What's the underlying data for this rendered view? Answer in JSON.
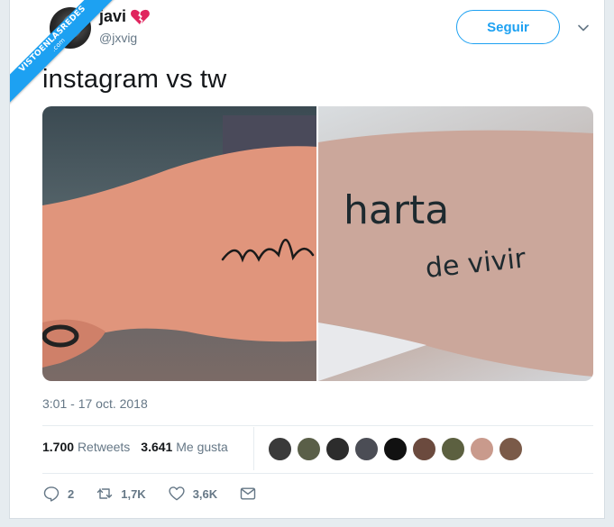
{
  "watermark": {
    "line1": "VISTOENLASREDES",
    "line2": ".com"
  },
  "tweet": {
    "author_name": "javi",
    "author_handle": "@jxvig",
    "follow_label": "Seguir",
    "text": "instagram vs tw",
    "timestamp": "3:01 - 17 oct. 2018"
  },
  "stats": {
    "retweets_count": "1.700",
    "retweets_label": "Retweets",
    "likes_count": "3.641",
    "likes_label": "Me gusta"
  },
  "actions": {
    "replies": "2",
    "retweets": "1,7K",
    "likes": "3,6K"
  },
  "media": {
    "left_tattoo_text": "art",
    "right_tattoo_line1": "harta",
    "right_tattoo_line2": "de vivir"
  },
  "colors": {
    "accent": "#1da1f2",
    "secondary_text": "#657786",
    "broken_heart": "#e0245e"
  },
  "icons": [
    "broken-heart-emoji",
    "chevron-down-icon",
    "reply-icon",
    "retweet-icon",
    "like-icon",
    "message-icon"
  ]
}
